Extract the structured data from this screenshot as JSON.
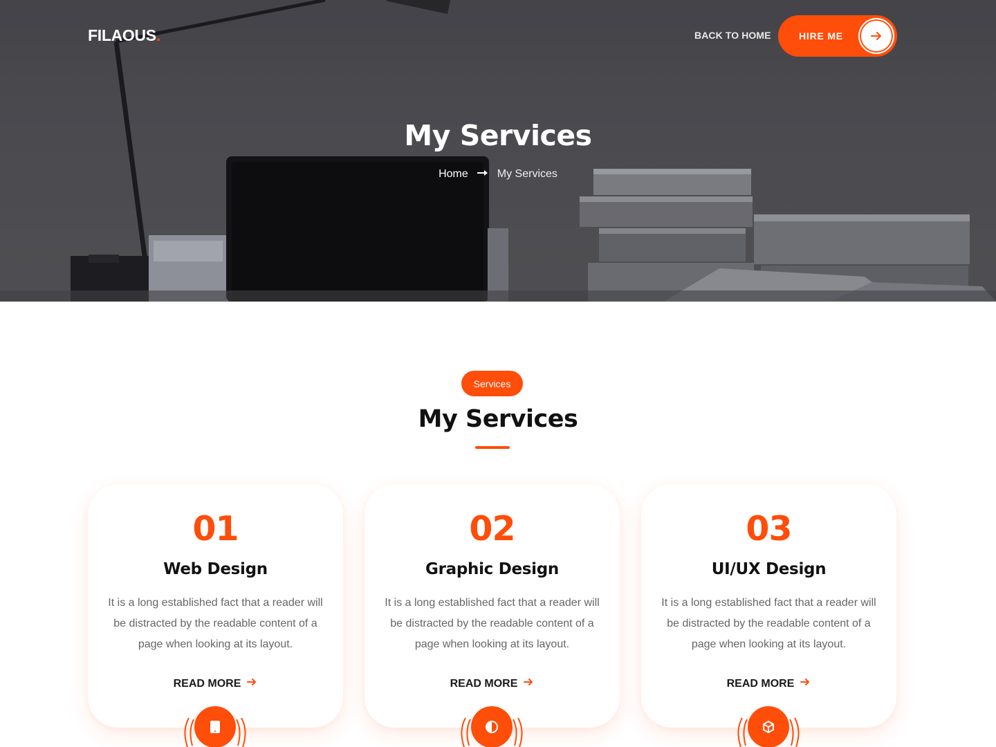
{
  "nav": {
    "logo": "FILAOUS",
    "logo_dot": ".",
    "back_home": "BACK TO HOME",
    "hire_me": "HIRE ME"
  },
  "hero": {
    "title": "My Services",
    "breadcrumb": {
      "home": "Home",
      "current": "My Services"
    }
  },
  "services": {
    "badge": "Services",
    "title": "My Services",
    "cards": [
      {
        "number": "01",
        "title": "Web Design",
        "description": "It is a long established fact that a reader will be distracted by the readable content of a page when looking at its layout.",
        "link": "READ MORE",
        "icon": "tablet-icon"
      },
      {
        "number": "02",
        "title": "Graphic Design",
        "description": "It is a long established fact that a reader will be distracted by the readable content of a page when looking at its layout.",
        "link": "READ MORE",
        "icon": "contrast-icon"
      },
      {
        "number": "03",
        "title": "UI/UX Design",
        "description": "It is a long established fact that a reader will be distracted by the readable content of a page when looking at its layout.",
        "link": "READ MORE",
        "icon": "cube-icon"
      }
    ]
  },
  "colors": {
    "accent": "#ff4d0a",
    "hero_bg": "#55555a",
    "heading": "#111111",
    "body_text": "#666666"
  }
}
